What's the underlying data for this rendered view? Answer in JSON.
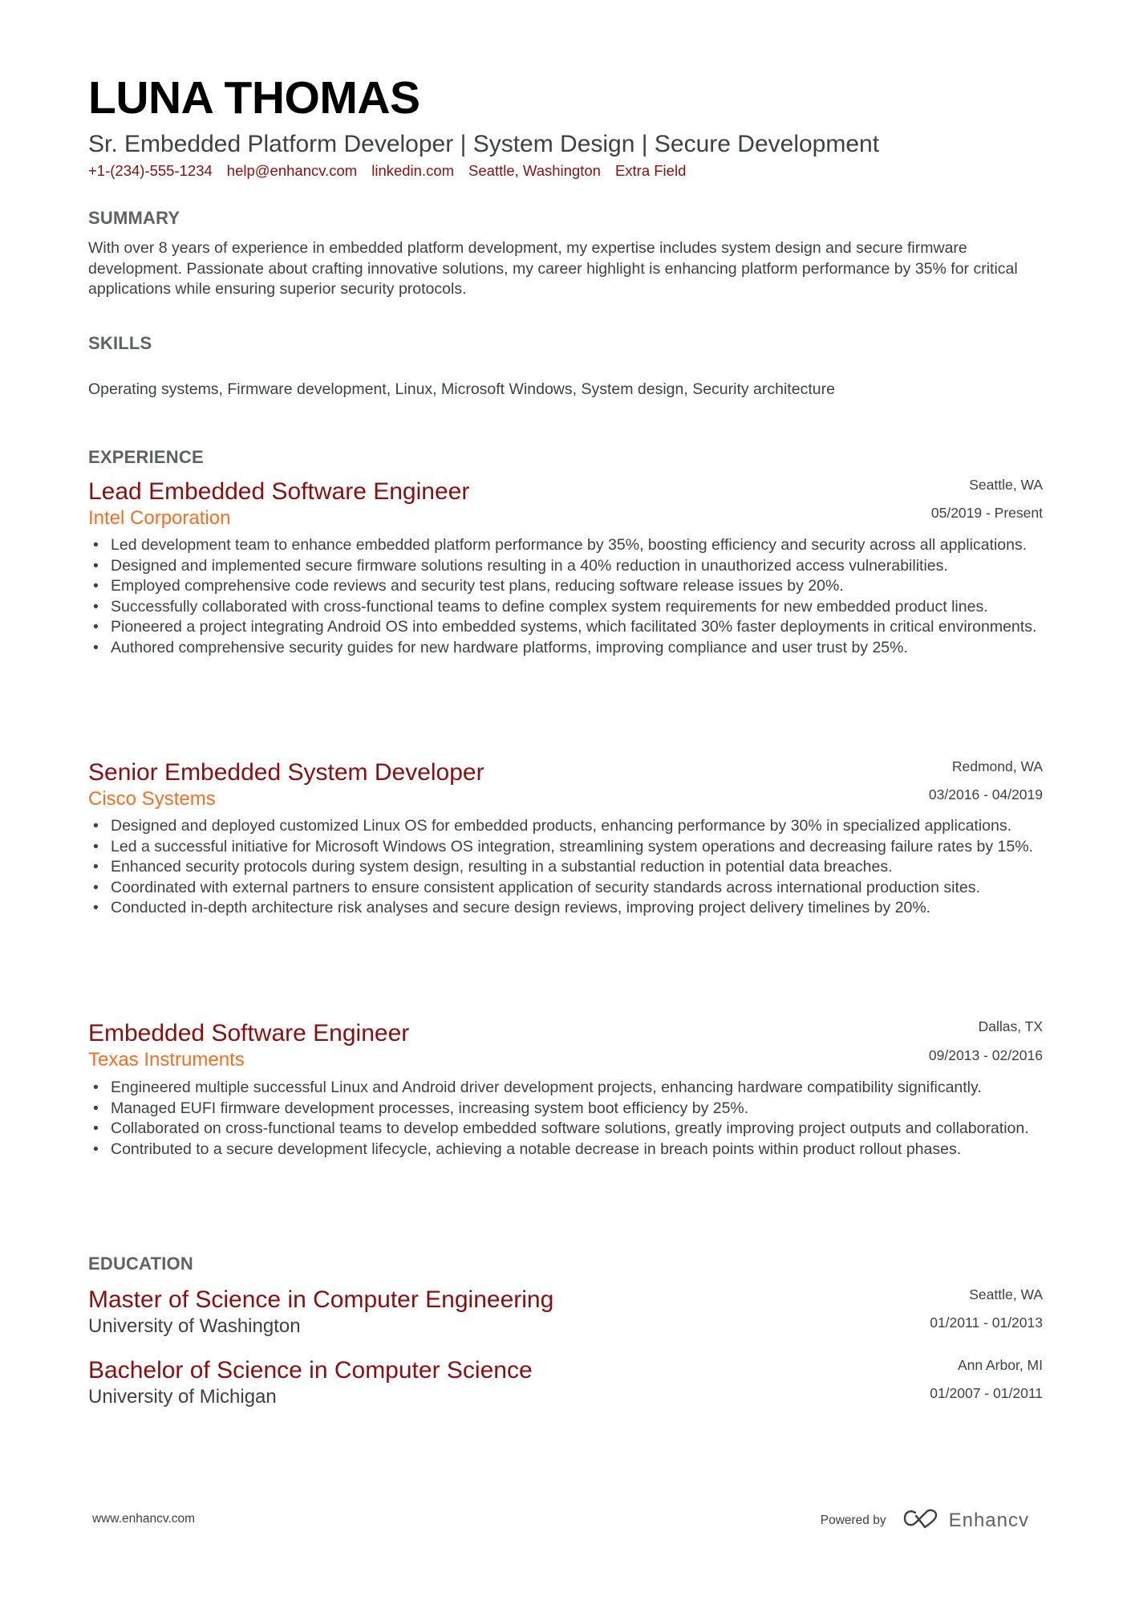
{
  "header": {
    "name": "LUNA THOMAS",
    "subtitle": "Sr. Embedded Platform Developer | System Design | Secure Development",
    "contacts": [
      "+1-(234)-555-1234",
      "help@enhancv.com",
      "linkedin.com",
      "Seattle, Washington",
      "Extra Field"
    ]
  },
  "summary": {
    "title": "SUMMARY",
    "text": "With over 8 years of experience in embedded platform development, my expertise includes system design and secure firmware development. Passionate about crafting innovative solutions, my career highlight is enhancing platform performance by 35% for critical applications while ensuring superior security protocols."
  },
  "skills": {
    "title": "SKILLS",
    "text": "Operating systems, Firmware development, Linux, Microsoft Windows, System design, Security architecture"
  },
  "experience": {
    "title": "EXPERIENCE",
    "jobs": [
      {
        "title": "Lead Embedded Software Engineer",
        "company": "Intel Corporation",
        "location": "Seattle, WA",
        "dates": "05/2019 - Present",
        "bullets": [
          "Led development team to enhance embedded platform performance by 35%, boosting efficiency and security across all applications.",
          "Designed and implemented secure firmware solutions resulting in a 40% reduction in unauthorized access vulnerabilities.",
          "Employed comprehensive code reviews and security test plans, reducing software release issues by 20%.",
          "Successfully collaborated with cross-functional teams to define complex system requirements for new embedded product lines.",
          "Pioneered a project integrating Android OS into embedded systems, which facilitated 30% faster deployments in critical environments.",
          "Authored comprehensive security guides for new hardware platforms, improving compliance and user trust by 25%."
        ]
      },
      {
        "title": "Senior Embedded System Developer",
        "company": "Cisco Systems",
        "location": "Redmond, WA",
        "dates": "03/2016 - 04/2019",
        "bullets": [
          "Designed and deployed customized Linux OS for embedded products, enhancing performance by 30% in specialized applications.",
          "Led a successful initiative for Microsoft Windows OS integration, streamlining system operations and decreasing failure rates by 15%.",
          "Enhanced security protocols during system design, resulting in a substantial reduction in potential data breaches.",
          "Coordinated with external partners to ensure consistent application of security standards across international production sites.",
          "Conducted in-depth architecture risk analyses and secure design reviews, improving project delivery timelines by 20%."
        ]
      },
      {
        "title": "Embedded Software Engineer",
        "company": "Texas Instruments",
        "location": "Dallas, TX",
        "dates": "09/2013 - 02/2016",
        "bullets": [
          "Engineered multiple successful Linux and Android driver development projects, enhancing hardware compatibility significantly.",
          "Managed EUFI firmware development processes, increasing system boot efficiency by 25%.",
          "Collaborated on cross-functional teams to develop embedded software solutions, greatly improving project outputs and collaboration.",
          "Contributed to a secure development lifecycle, achieving a notable decrease in breach points within product rollout phases."
        ]
      }
    ]
  },
  "education": {
    "title": "EDUCATION",
    "items": [
      {
        "degree": "Master of Science in Computer Engineering",
        "school": "University of Washington",
        "location": "Seattle, WA",
        "dates": "01/2011 - 01/2013"
      },
      {
        "degree": "Bachelor of Science in Computer Science",
        "school": "University of Michigan",
        "location": "Ann Arbor, MI",
        "dates": "01/2007 - 01/2011"
      }
    ]
  },
  "footer": {
    "website": "www.enhancv.com",
    "powered_by": "Powered by",
    "brand": "Enhancv",
    "brand_icon": "enhancv-logo-icon"
  },
  "colors": {
    "name": "#000000",
    "accent_title": "#8b0e0e",
    "accent_company": "#f36f21",
    "section_heading": "#5b6367",
    "body_text": "#3b4246"
  }
}
